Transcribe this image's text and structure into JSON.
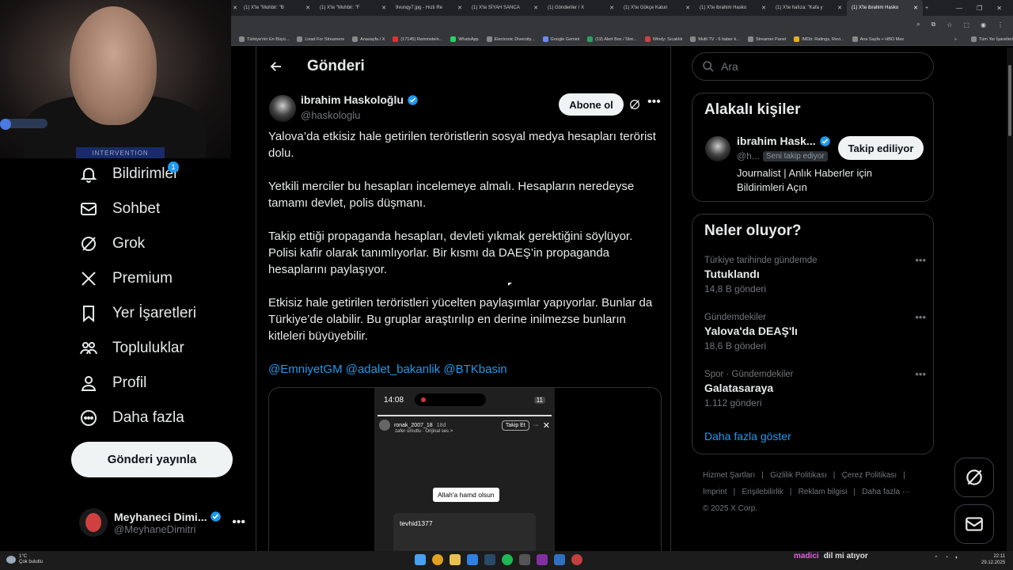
{
  "browser": {
    "tabs": [
      "(1) X'te \"Muhbir: \"B",
      "(1) X'te \"Muhbir: \"F",
      "9vunqy7.jpg - Hızlı Re",
      "(1) X'te SİYAH SANCA",
      "(1) Gönderiler / X",
      "(1) X'te Gökçe Katun",
      "(1) X'te ibrahim Hasko",
      "(1) X'te hafıza: \"Kafa y",
      "(1) X'te ibrahim Hasko"
    ],
    "bookmarks": [
      "Türkiye'nin En Büyü...",
      "Livad For Streamers",
      "Anasayfa / X",
      "(17145) Rammstein...",
      "WhatsApp",
      "Electronic Diversity...",
      "Google Gemini",
      "(19) Alert Box / Stre...",
      "Windy: Sıcaklık",
      "Multi TV - 6 haber k...",
      "Streamer Panel",
      "IMDb: Ratings, Revi...",
      "Ana Sayfa + HBO Max"
    ],
    "all_bookmarks": "Tüm Yer İşaretleri"
  },
  "webcam": {
    "shirt_text": "INTERVENTION"
  },
  "nav": {
    "notifications_badge": "1",
    "items": [
      {
        "label": "Bildirimler",
        "icon": "bell-icon"
      },
      {
        "label": "Sohbet",
        "icon": "mail-icon"
      },
      {
        "label": "Grok",
        "icon": "grok-icon"
      },
      {
        "label": "Premium",
        "icon": "x-logo-icon"
      },
      {
        "label": "Yer İşaretleri",
        "icon": "bookmark-icon"
      },
      {
        "label": "Topluluklar",
        "icon": "communities-icon"
      },
      {
        "label": "Profil",
        "icon": "person-icon"
      },
      {
        "label": "Daha fazla",
        "icon": "more-circle-icon"
      }
    ],
    "post_button": "Gönderi yayınla",
    "account": {
      "name": "Meyhaneci Dimi...",
      "handle": "@MeyhaneDimitri"
    }
  },
  "main": {
    "title": "Gönderi",
    "author": {
      "name": "ibrahim Haskoloğlu",
      "handle": "@haskologlu"
    },
    "subscribe_label": "Abone ol",
    "paragraphs": [
      "Yalova’da etkisiz hale getirilen teröristlerin sosyal medya hesapları terörist dolu.",
      "Yetkili merciler bu hesapları incelemeye almalı. Hesapların neredeyse tamamı devlet, polis düşmanı.",
      "Takip ettiği propaganda hesapları, devleti yıkmak gerektiğini söylüyor. Polisi kafir olarak tanımlıyorlar. Bir kısmı da DAEŞ’in propaganda hesaplarını paylaşıyor.",
      "Etkisiz hale getirilen teröristleri yücelten paylaşımlar yapıyorlar. Bunlar da Türkiye’de olabilir. Bu gruplar araştırılıp en derine inilmezse bunların kitleleri büyüyebilir."
    ],
    "mentions": "@EmniyetGM @adalet_bakanlik @BTKbasin",
    "media": {
      "time": "14:08",
      "battery": "11",
      "story_user": "ronak_2007_18",
      "story_age": "18d",
      "story_sub": "zafer umutlu · Orijinal ses >",
      "follow_label": "Takip Et",
      "sticker": "Allah'a hamd olsun",
      "card_user": "tevhid1377"
    }
  },
  "sidebar": {
    "search_placeholder": "Ara",
    "related": {
      "title": "Alakalı kişiler",
      "name": "ibrahim Hask...",
      "handle": "@h...",
      "follows_you": "Seni takip ediyor",
      "follow_label": "Takip ediliyor",
      "bio": "Journalist | Anlık Haberler için Bildirimleri Açın"
    },
    "trends": {
      "title": "Neler oluyor?",
      "items": [
        {
          "context": "Türkiye tarihinde gündemde",
          "title": "Tutuklandı",
          "count": "14,8 B gönderi"
        },
        {
          "context": "Gündemdekiler",
          "title": "Yalova'da DEAŞ'lı",
          "count": "18,6 B gönderi"
        },
        {
          "context": "Spor · Gündemdekiler",
          "title": "Galatasaraya",
          "count": "1.112 gönderi"
        }
      ],
      "show_more": "Daha fazla göster"
    },
    "footer": [
      "Hizmet Şartları",
      "Gizlilik Politikası",
      "Çerez Politikası",
      "Imprint",
      "Erişilebilirlik",
      "Reklam bilgisi",
      "Daha fazla ···",
      "© 2025 X Corp."
    ]
  },
  "taskbar": {
    "temp": "1°C",
    "weather": "Çok bulutlu",
    "overlay_user": "madici",
    "overlay_msg": "dil mi atıyor",
    "time": "22:11",
    "date": "29.12.2025"
  },
  "colors": {
    "accent": "#1d9bf0",
    "background": "#000000",
    "border": "#2f3336",
    "muted": "#71767b"
  }
}
